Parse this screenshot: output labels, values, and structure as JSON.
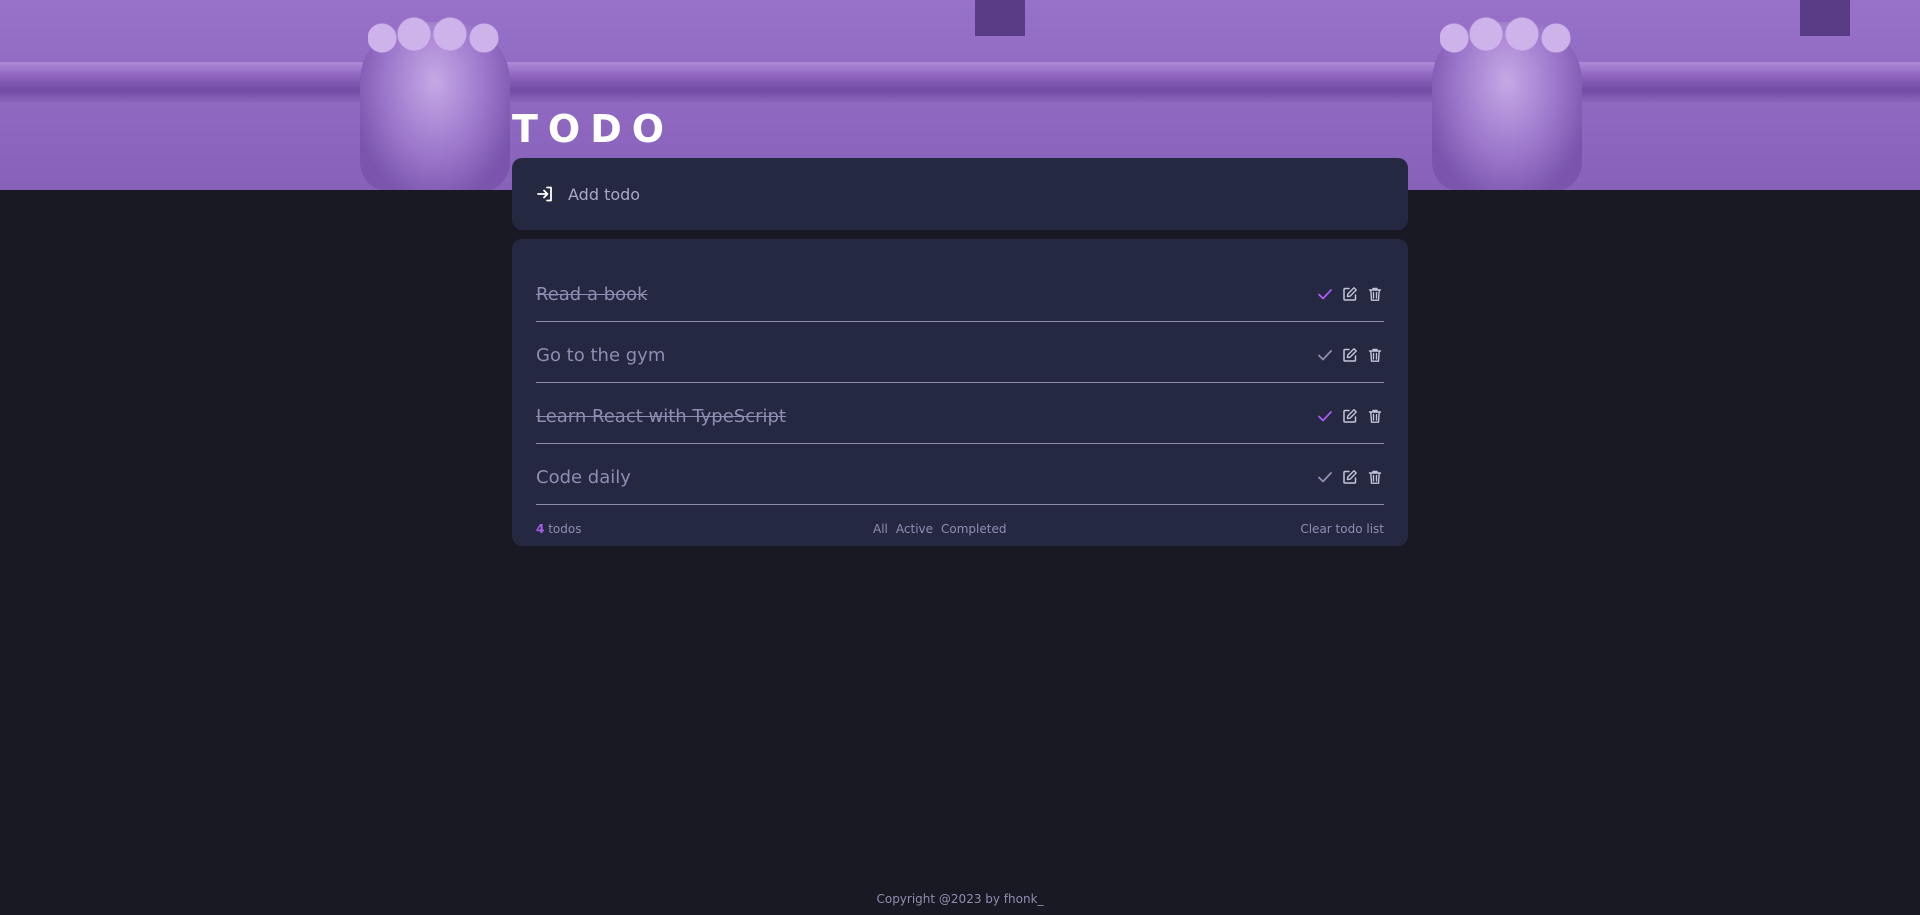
{
  "app": {
    "title": "TODO"
  },
  "add_todo": {
    "placeholder": "Add todo",
    "icon": "login-enter-icon"
  },
  "todos": [
    {
      "text": "Read a book",
      "completed": true
    },
    {
      "text": "Go to the gym",
      "completed": false
    },
    {
      "text": "Learn React with TypeScript",
      "completed": true
    },
    {
      "text": "Code daily",
      "completed": false
    }
  ],
  "footer": {
    "count": "4",
    "count_label": "todos",
    "filters": [
      "All",
      "Active",
      "Completed"
    ],
    "clear_label": "Clear todo list"
  },
  "copyright": "Copyright @2023 by fhonk_",
  "colors": {
    "background": "#181923",
    "card": "#252841",
    "hero": "#8f66c4",
    "accent": "#a75ef0",
    "muted_text": "#8f8db2"
  }
}
